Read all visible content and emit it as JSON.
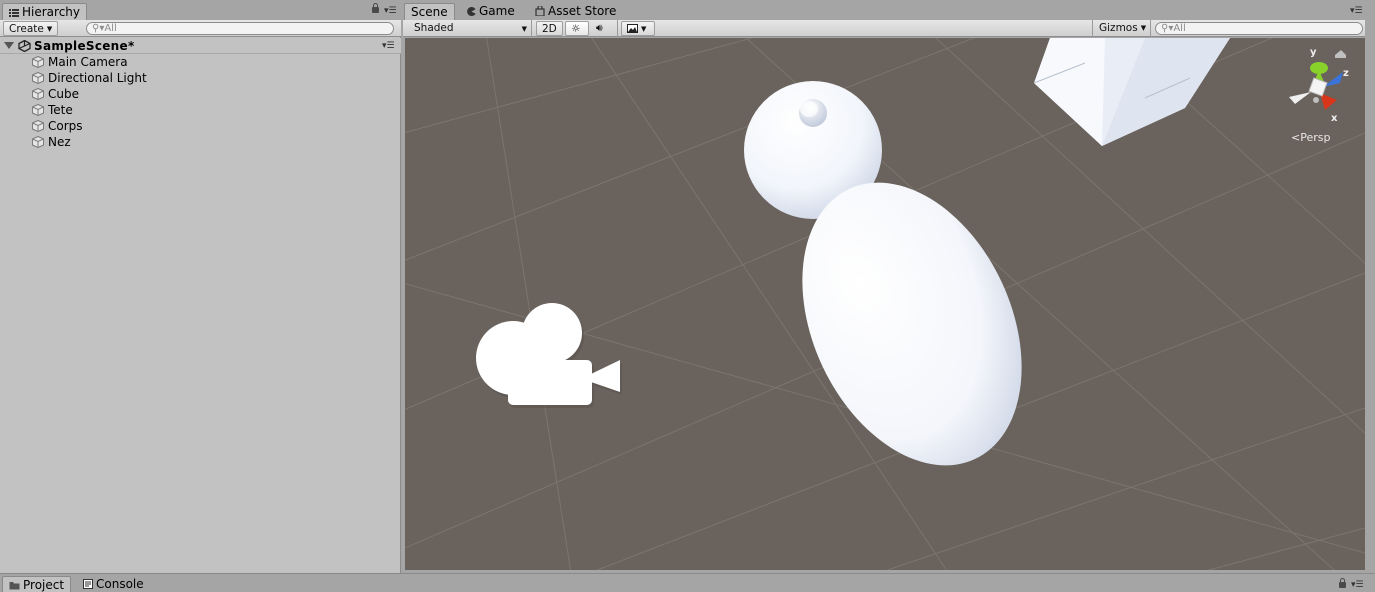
{
  "hierarchy": {
    "tab_label": "Hierarchy",
    "create_label": "Create",
    "search_placeholder": "All",
    "scene_name": "SampleScene*",
    "items": [
      {
        "label": "Main Camera"
      },
      {
        "label": "Directional Light"
      },
      {
        "label": "Cube"
      },
      {
        "label": "Tete"
      },
      {
        "label": "Corps"
      },
      {
        "label": "Nez"
      }
    ]
  },
  "scene_view": {
    "tabs": [
      {
        "label": "Scene",
        "active": true
      },
      {
        "label": "Game",
        "active": false
      },
      {
        "label": "Asset Store",
        "active": false
      }
    ],
    "draw_mode": "Shaded",
    "toggle_2d": "2D",
    "gizmos_label": "Gizmos",
    "search_placeholder": "All",
    "projection_label": "Persp",
    "axis_labels": {
      "x": "x",
      "y": "y",
      "z": "z"
    }
  },
  "bottom_tabs": [
    {
      "label": "Project",
      "active": true
    },
    {
      "label": "Console",
      "active": false
    }
  ],
  "colors": {
    "viewport_background": "#6a625c",
    "grid_line": "#7c756f",
    "axis_x": "#d7361a",
    "axis_y": "#88d12a",
    "axis_z": "#3a73d9"
  },
  "icons": {
    "hierarchy_tab": "list-icon",
    "game_tab": "pacman-icon",
    "asset_store_tab": "store-bag-icon",
    "lighting": "sun-icon",
    "audio": "speaker-icon",
    "effects": "image-icon",
    "scene_objects": "cube-icon",
    "camera_gizmo": "camera-icon"
  }
}
